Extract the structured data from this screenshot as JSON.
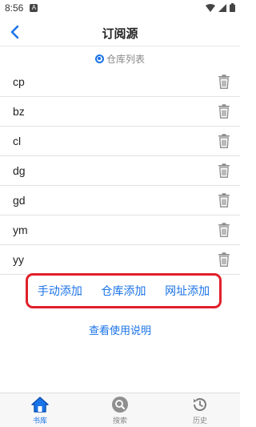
{
  "status_bar": {
    "time": "8:56",
    "app_badge": "A"
  },
  "header": {
    "title": "订阅源"
  },
  "repo_label": "仓库列表",
  "sources": [
    {
      "name": "cp"
    },
    {
      "name": "bz"
    },
    {
      "name": "cl"
    },
    {
      "name": "dg"
    },
    {
      "name": "gd"
    },
    {
      "name": "ym"
    },
    {
      "name": "yy"
    }
  ],
  "add_actions": {
    "manual": "手动添加",
    "repo": "仓库添加",
    "url": "网址添加"
  },
  "help_link": "查看使用说明",
  "bottom_nav": {
    "library": "书库",
    "search": "搜索",
    "history": "历史"
  },
  "colors": {
    "accent": "#1a73e8",
    "highlight_border": "#e0202a"
  },
  "icons": [
    "back-arrow-icon",
    "radio-selected-icon",
    "trash-icon",
    "home-icon",
    "search-icon",
    "history-icon",
    "wifi-icon",
    "signal-icon",
    "battery-icon"
  ]
}
